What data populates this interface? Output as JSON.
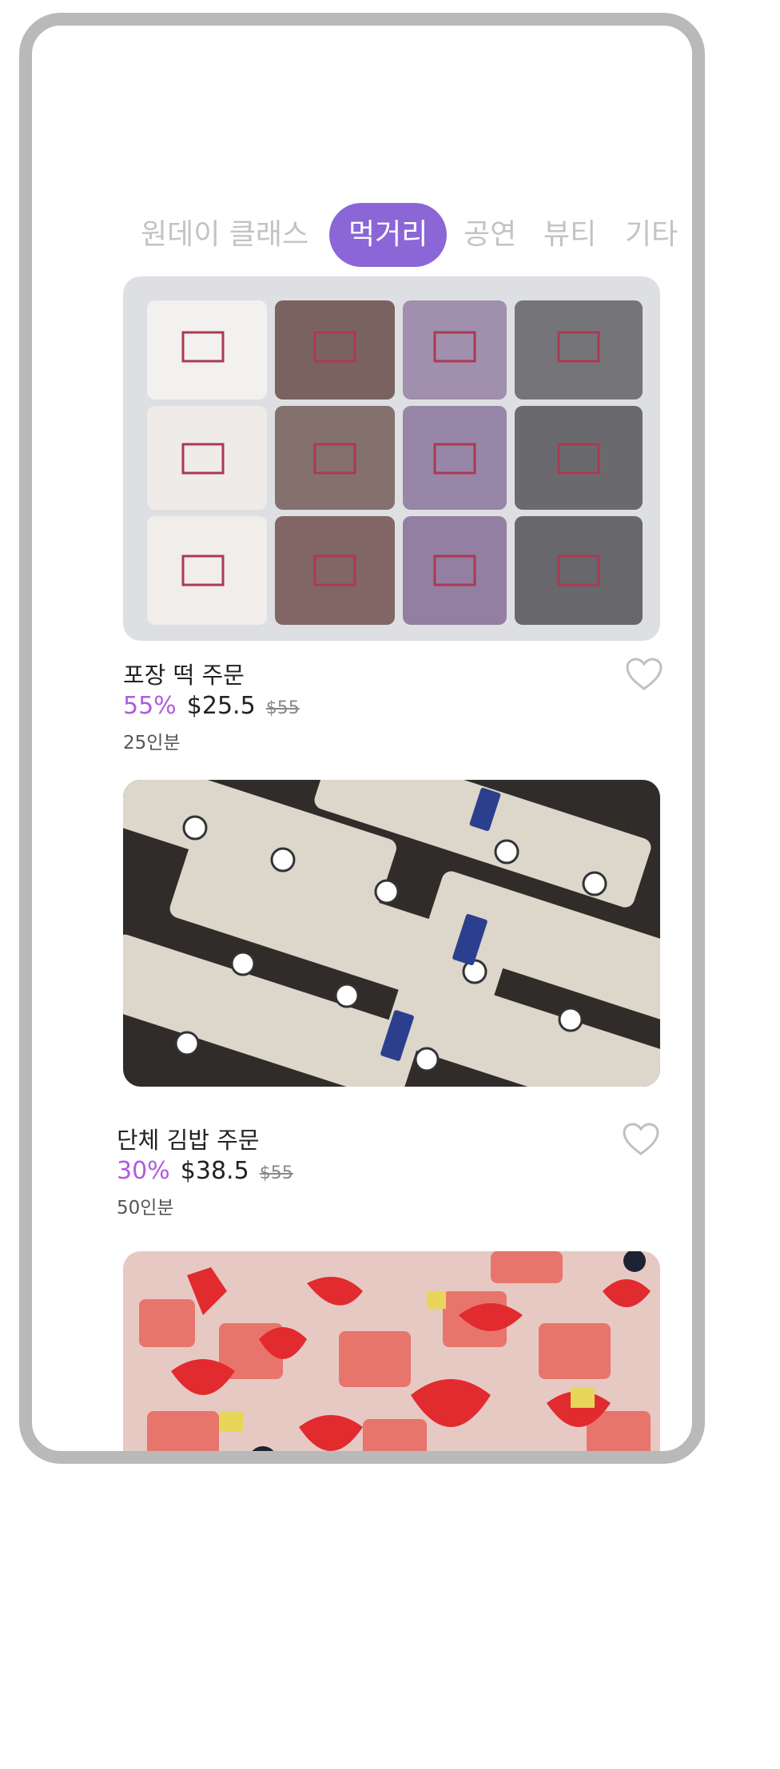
{
  "tabs": [
    {
      "label": "원데이 클래스",
      "active": false
    },
    {
      "label": "먹거리",
      "active": true
    },
    {
      "label": "공연",
      "active": false
    },
    {
      "label": "뷰티",
      "active": false
    },
    {
      "label": "기타",
      "active": false
    }
  ],
  "products": [
    {
      "title": "포장 떡 주문",
      "discount": "55%",
      "price": "$25.5",
      "original_price": "$55",
      "servings": "25인분",
      "image": "packaged-rice-cakes",
      "favorited": false
    },
    {
      "title": "단체 김밥 주문",
      "discount": "30%",
      "price": "$38.5",
      "original_price": "$55",
      "servings": "50인분",
      "image": "packaged-kimbap-rolls",
      "favorited": false
    },
    {
      "image": "fruit-cups-strawberry-watermelon"
    }
  ],
  "colors": {
    "accent": "#8a66d6",
    "discount": "#b05be0",
    "inactive_tab": "#c3c3c3",
    "frame": "#b9b9b9"
  }
}
